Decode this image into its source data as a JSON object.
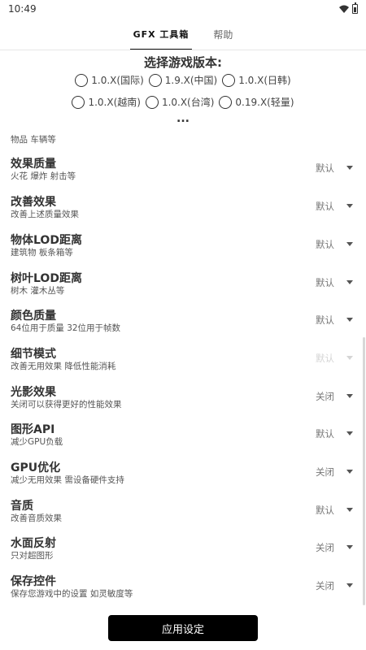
{
  "status_bar": {
    "time": "10:49"
  },
  "tabs": [
    {
      "label": "GFX 工具箱",
      "active": true
    },
    {
      "label": "帮助",
      "active": false
    }
  ],
  "version_select": {
    "title": "选择游戏版本:",
    "options_row1": [
      "1.0.X(国际)",
      "1.9.X(中国)",
      "1.0.X(日韩)"
    ],
    "options_row2": [
      "1.0.X(越南)",
      "1.0.X(台湾)",
      "0.19.X(轻量)"
    ],
    "more": "..."
  },
  "partial_item": {
    "desc": "物品 车辆等"
  },
  "settings": [
    {
      "title": "效果质量",
      "desc": "火花 爆炸 射击等",
      "value": "默认",
      "disabled": false
    },
    {
      "title": "改善效果",
      "desc": "改善上述质量效果",
      "value": "默认",
      "disabled": false
    },
    {
      "title": "物体LOD距离",
      "desc": "建筑物 板条箱等",
      "value": "默认",
      "disabled": false
    },
    {
      "title": "树叶LOD距离",
      "desc": "树木 灌木丛等",
      "value": "默认",
      "disabled": false
    },
    {
      "title": "颜色质量",
      "desc": "64位用于质量 32位用于帧数",
      "value": "默认",
      "disabled": false
    },
    {
      "title": "细节模式",
      "desc": "改善无用效果 降低性能消耗",
      "value": "默认",
      "disabled": true
    },
    {
      "title": "光影效果",
      "desc": "关闭可以获得更好的性能效果",
      "value": "关闭",
      "disabled": false
    },
    {
      "title": "图形API",
      "desc": "减少GPU负载",
      "value": "默认",
      "disabled": false
    },
    {
      "title": "GPU优化",
      "desc": "减少无用效果 需设备硬件支持",
      "value": "关闭",
      "disabled": false
    },
    {
      "title": "音质",
      "desc": "改善音质效果",
      "value": "默认",
      "disabled": false
    },
    {
      "title": "水面反射",
      "desc": "只对超图形",
      "value": "关闭",
      "disabled": false
    },
    {
      "title": "保存控件",
      "desc": "保存您游戏中的设置 如灵敏度等",
      "value": "关闭",
      "disabled": false
    }
  ],
  "apply_button": {
    "label": "应用设定"
  },
  "colors": {
    "accent": "#000000",
    "background": "#ffffff"
  }
}
